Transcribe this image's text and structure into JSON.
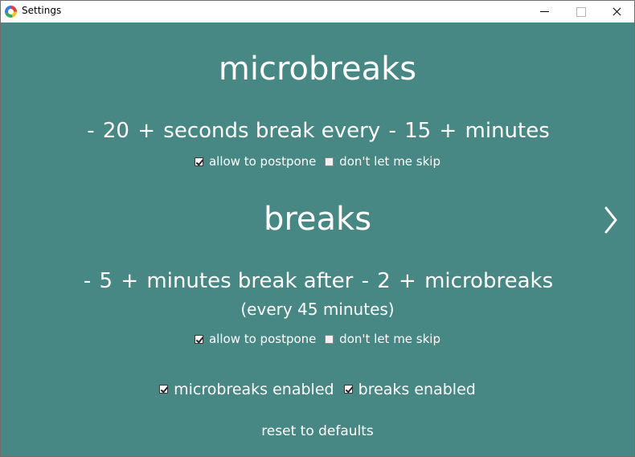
{
  "window": {
    "title": "Settings"
  },
  "microbreaks": {
    "heading": "microbreaks",
    "decrement_duration": "-",
    "duration": "20",
    "increment_duration": "+",
    "text_mid": "seconds break every",
    "decrement_interval": "-",
    "interval": "15",
    "increment_interval": "+",
    "text_end": "minutes",
    "postpone_label": "allow to postpone",
    "postpone_checked": true,
    "noskip_label": "don't let me skip",
    "noskip_checked": false
  },
  "breaks": {
    "heading": "breaks",
    "decrement_duration": "-",
    "duration": "5",
    "increment_duration": "+",
    "text_mid": "minutes break after",
    "decrement_after": "-",
    "after": "2",
    "increment_after": "+",
    "text_end": "microbreaks",
    "note": "(every 45 minutes)",
    "postpone_label": "allow to postpone",
    "postpone_checked": true,
    "noskip_label": "don't let me skip",
    "noskip_checked": false
  },
  "toggles": {
    "microbreaks_enabled_label": "microbreaks enabled",
    "microbreaks_enabled": true,
    "breaks_enabled_label": "breaks enabled",
    "breaks_enabled": true
  },
  "footer": {
    "reset_label": "reset to defaults"
  },
  "icons": {
    "app": "app-logo-icon",
    "minimize": "minimize-icon",
    "maximize": "maximize-icon",
    "close": "close-icon",
    "next": "chevron-right-icon"
  },
  "colors": {
    "background": "#478784",
    "text": "#ffffff"
  }
}
